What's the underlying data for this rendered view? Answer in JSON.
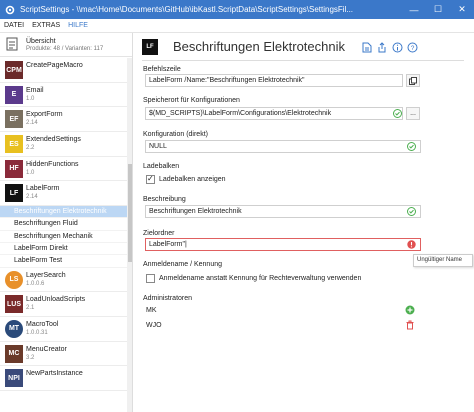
{
  "window": {
    "title": "ScriptSettings - \\\\mac\\Home\\Documents\\GitHub\\ibKastl.ScriptData\\ScriptSettings\\SettingsFil...",
    "controls": {
      "minimize": "—",
      "maximize": "☐",
      "close": "✕"
    }
  },
  "menu": {
    "items": [
      "DATEI",
      "EXTRAS",
      "HILFE"
    ]
  },
  "sidebar": {
    "overview": {
      "title": "Übersicht",
      "subtitle": "Produkte: 48 / Varianten: 117"
    },
    "items": [
      {
        "badge": "CPM",
        "color": "#6b2a2a",
        "name": "CreatePageMacro",
        "version": "",
        "round": false
      },
      {
        "badge": "E",
        "color": "#5b3a8c",
        "name": "Email",
        "version": "1.0",
        "round": false
      },
      {
        "badge": "EF",
        "color": "#7a7060",
        "name": "ExportForm",
        "version": "2.14",
        "round": false
      },
      {
        "badge": "ES",
        "color": "#e8c020",
        "name": "ExtendedSettings",
        "version": "2.2",
        "round": false
      },
      {
        "badge": "HF",
        "color": "#8a2a3a",
        "name": "HiddenFunctions",
        "version": "1.0",
        "round": false
      },
      {
        "badge": "LF",
        "color": "#111111",
        "name": "LabelForm",
        "version": "2.14",
        "round": false
      }
    ],
    "subitems": [
      "Beschriftungen Elektrotechnik",
      "Beschriftungen Fluid",
      "Beschriftungen Mechanik",
      "LabelForm Direkt",
      "LabelForm Test"
    ],
    "selected_subitem": 0,
    "items_after": [
      {
        "badge": "LS",
        "color": "#e8902a",
        "name": "LayerSearch",
        "version": "1.0.0.6",
        "round": true
      },
      {
        "badge": "LUS",
        "color": "#7a2a2a",
        "name": "LoadUnloadScripts",
        "version": "2.1",
        "round": false
      },
      {
        "badge": "MT",
        "color": "#2a4a7a",
        "name": "MacroTool",
        "version": "1.0.0.31",
        "round": true
      },
      {
        "badge": "MC",
        "color": "#6a3a2a",
        "name": "MenuCreator",
        "version": "3.2",
        "round": false
      },
      {
        "badge": "NPI",
        "color": "#3a4a7a",
        "name": "NewPartsInstance",
        "version": "",
        "round": false
      }
    ]
  },
  "main": {
    "badge": "LF",
    "title": "Beschriftungen Elektrotechnik",
    "sections": {
      "befehlszeile": {
        "label": "Befehlszeile",
        "value": "LabelForm /Name:\"Beschriftungen Elektrotechnik\""
      },
      "speicherort": {
        "label": "Speicherort für Konfigurationen",
        "value": "$(MD_SCRIPTS)\\LabelForm\\Configurations\\Elektrotechnik",
        "button": "..."
      },
      "konfiguration": {
        "label": "Konfiguration (direkt)",
        "value": "NULL"
      },
      "ladebalken": {
        "label": "Ladebalken",
        "checkbox_label": "Ladebalken anzeigen",
        "checked": true
      },
      "beschreibung": {
        "label": "Beschreibung",
        "value": "Beschriftungen Elektrotechnik"
      },
      "zielordner": {
        "label": "Zielordner",
        "value": "LabelForm\"|"
      },
      "anmeldename": {
        "label": "Anmeldename / Kennung",
        "checkbox_label": "Anmeldename anstatt Kennung für Rechteverwaltung verwenden",
        "checked": false
      },
      "administratoren": {
        "label": "Administratoren",
        "entries": [
          "MK",
          "WJO"
        ]
      }
    },
    "tooltip": "Ungültiger Name"
  },
  "colors": {
    "accent": "#3b78c9",
    "ok": "#4caf50",
    "error": "#e05050",
    "selection": "#bcd7f4"
  }
}
